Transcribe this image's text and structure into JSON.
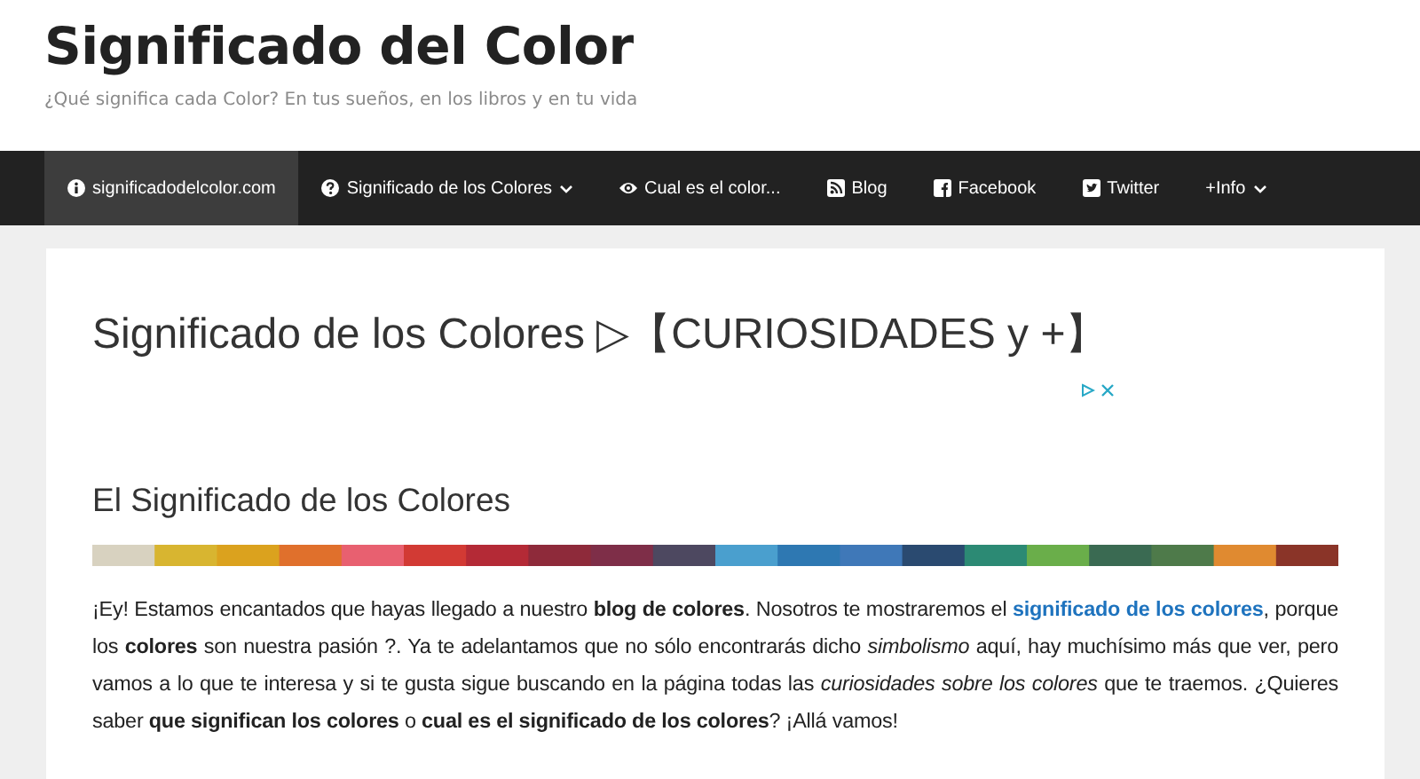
{
  "site": {
    "title": "Significado del Color",
    "tagline": "¿Qué significa cada Color? En tus sueños, en los libros y en tu vida"
  },
  "nav": [
    {
      "label": "significadodelcolor.com",
      "kind": "info",
      "dropdown": false,
      "selected": true
    },
    {
      "label": "Significado de los Colores",
      "kind": "question",
      "dropdown": true,
      "selected": false
    },
    {
      "label": "Cual es el color...",
      "kind": "eye",
      "dropdown": false,
      "selected": false
    },
    {
      "label": "Blog",
      "kind": "rss",
      "dropdown": false,
      "selected": false
    },
    {
      "label": "Facebook",
      "kind": "facebook",
      "dropdown": false,
      "selected": false
    },
    {
      "label": "Twitter",
      "kind": "twitter",
      "dropdown": false,
      "selected": false
    },
    {
      "label": "+Info",
      "kind": "plain",
      "dropdown": true,
      "selected": false
    }
  ],
  "article": {
    "title": "Significado de los Colores ▷【CURIOSIDADES y +】",
    "section_heading": "El Significado de los Colores",
    "intro": {
      "before": "¡Ey! Estamos encantados que hayas llegado a nuestro **blog de colores**. Nosotros te mostraremos el ",
      "link": "significado de los colores",
      "after": ", porque los **colores** son nuestra pasión ?. Ya te adelantamos que no sólo encontrarás dicho *simbolismo* aquí, hay muchísimo más que ver, pero vamos a lo que te interesa y si te gusta sigue buscando en la página todas las *curiosidades sobre los colores* que te traemos. ¿Quieres saber **que significan los colores** o **cual es el significado de los colores**? ¡Allá vamos!"
    }
  }
}
